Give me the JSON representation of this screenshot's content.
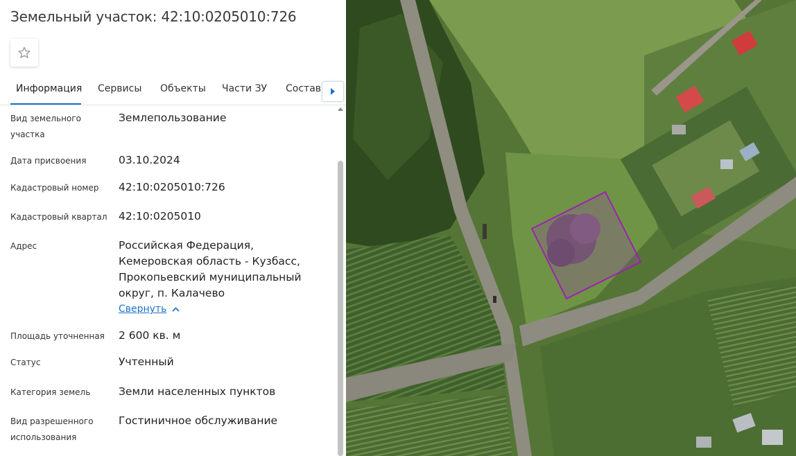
{
  "page": {
    "title": "Земельный участок: 42:10:0205010:726"
  },
  "tabs": [
    {
      "label": "Информация",
      "active": true
    },
    {
      "label": "Сервисы",
      "active": false
    },
    {
      "label": "Объекты",
      "active": false
    },
    {
      "label": "Части ЗУ",
      "active": false
    },
    {
      "label": "Состав",
      "active": false
    }
  ],
  "fields": [
    {
      "label": "Вид земельного участка",
      "value": "Землепользование"
    },
    {
      "label": "Дата присвоения",
      "value": "03.10.2024"
    },
    {
      "label": "Кадастровый номер",
      "value": "42:10:0205010:726"
    },
    {
      "label": "Кадастровый квартал",
      "value": "42:10:0205010"
    },
    {
      "label": "Адрес",
      "value": "Российская Федерация, Кемеровская область - Кузбасс, Прокопьевский муниципальный округ, п. Калачево"
    },
    {
      "label": "Площадь уточненная",
      "value": "2 600 кв. м"
    },
    {
      "label": "Статус",
      "value": "Учтенный"
    },
    {
      "label": "Категория земель",
      "value": "Земли населенных пунктов"
    },
    {
      "label": "Вид разрешенного использования",
      "value": "Гостиничное обслуживание"
    }
  ],
  "address_collapse_link": "Свернуть",
  "icons": {
    "favorite": "star-outline-icon",
    "tabs_next": "caret-right-icon",
    "collapse": "chevron-up-icon",
    "scroll_up": "caret-up-icon"
  },
  "colors": {
    "accent": "#1b73c9",
    "parcel_outline": "#a020b0"
  }
}
